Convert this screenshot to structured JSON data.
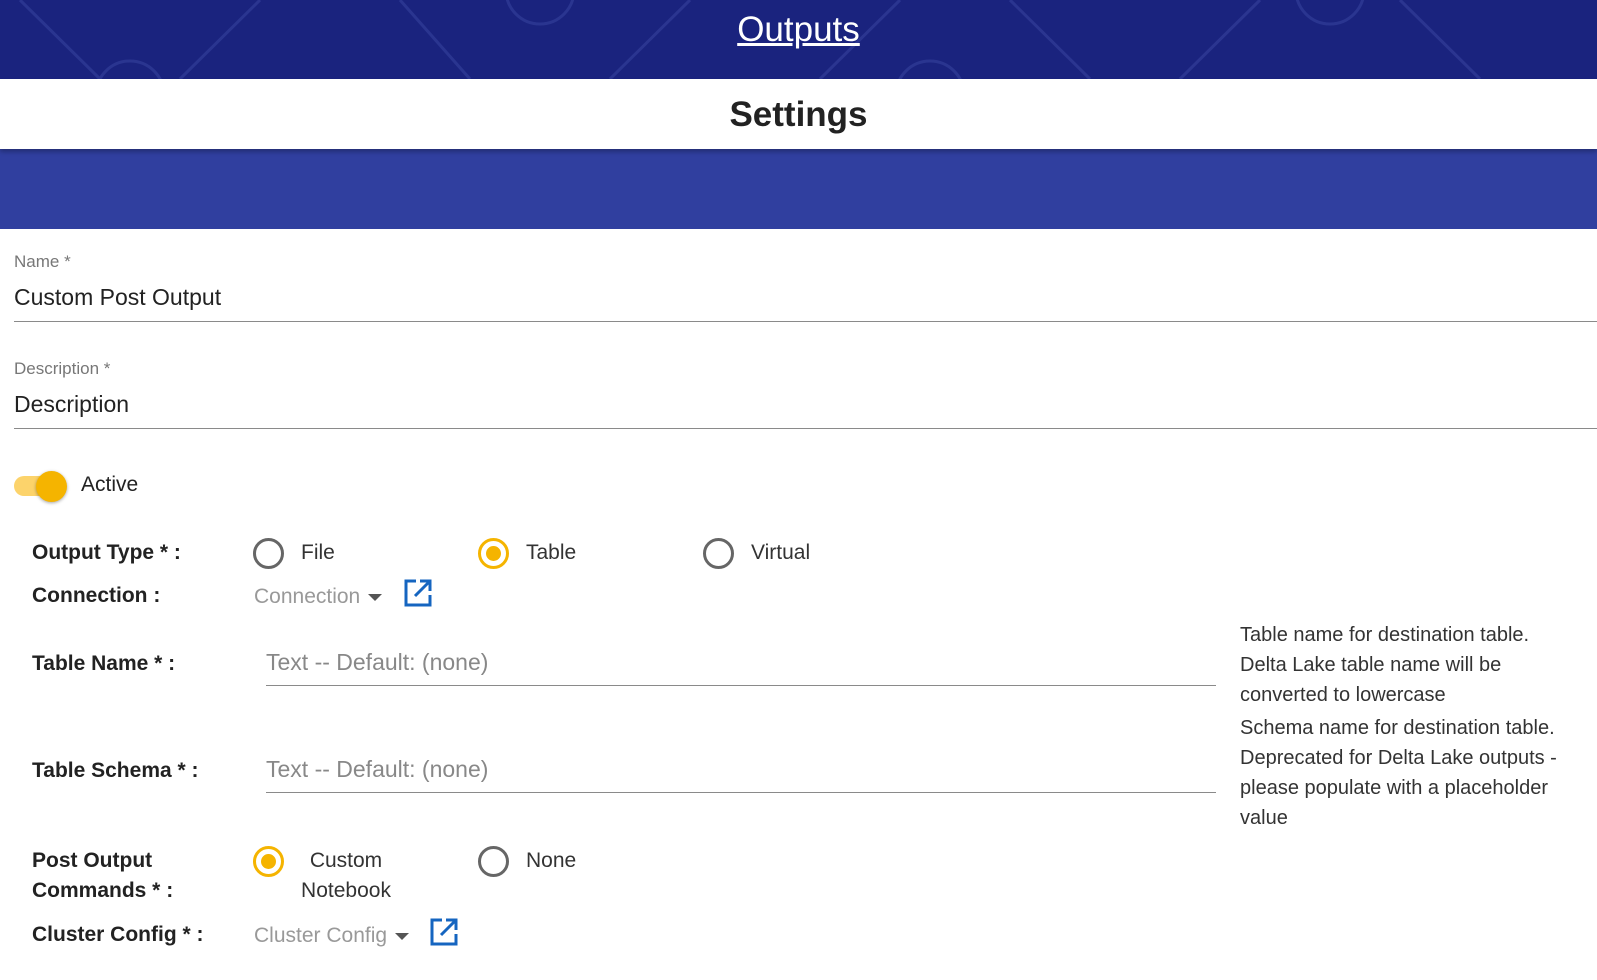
{
  "header": {
    "title": "Outputs"
  },
  "settings": {
    "title": "Settings"
  },
  "name_field": {
    "label": "Name *",
    "value": "Custom Post Output"
  },
  "description_field": {
    "label": "Description *",
    "value": "Description"
  },
  "active_toggle": {
    "label": "Active",
    "on": true
  },
  "output_type": {
    "label": "Output Type * :",
    "options": [
      "File",
      "Table",
      "Virtual"
    ],
    "selected": "Table"
  },
  "connection": {
    "label": "Connection :",
    "placeholder": "Connection",
    "open_icon": "open-in-new-icon"
  },
  "table_name": {
    "label": "Table Name * :",
    "placeholder": "Text -- Default: (none)",
    "help": [
      "Table name for destination table.",
      "Delta Lake table name will be",
      "converted to lowercase"
    ]
  },
  "table_schema": {
    "label": "Table Schema * :",
    "placeholder": "Text -- Default: (none)",
    "help": [
      "Schema name for destination table.",
      "Deprecated for Delta Lake outputs -",
      "please populate with a placeholder",
      "value"
    ]
  },
  "post_output_commands": {
    "label_lines": [
      "Post Output",
      "Commands * :"
    ],
    "options": [
      {
        "lines": [
          "Custom",
          "Notebook"
        ]
      },
      {
        "lines": [
          "None"
        ]
      }
    ],
    "selected": "Custom Notebook"
  },
  "cluster_config": {
    "label": "Cluster Config * :",
    "placeholder": "Cluster Config",
    "open_icon": "open-in-new-icon"
  },
  "colors": {
    "header_bg": "#1a237e",
    "band_bg": "#303f9f",
    "accent": "#f5b400",
    "link_icon": "#1565c0"
  }
}
